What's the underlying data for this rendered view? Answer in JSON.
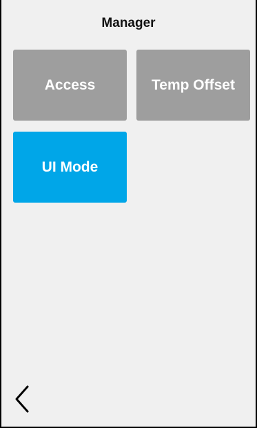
{
  "header": {
    "title": "Manager"
  },
  "tiles": [
    {
      "label": "Access",
      "color": "#9e9e9e"
    },
    {
      "label": "Temp Offset",
      "color": "#9e9e9e"
    },
    {
      "label": "UI Mode",
      "color": "#00a6e8"
    }
  ],
  "nav": {
    "back_icon": "chevron-left-icon"
  },
  "colors": {
    "background": "#f0f0f0",
    "accent": "#00a6e8",
    "inactive": "#9e9e9e"
  }
}
